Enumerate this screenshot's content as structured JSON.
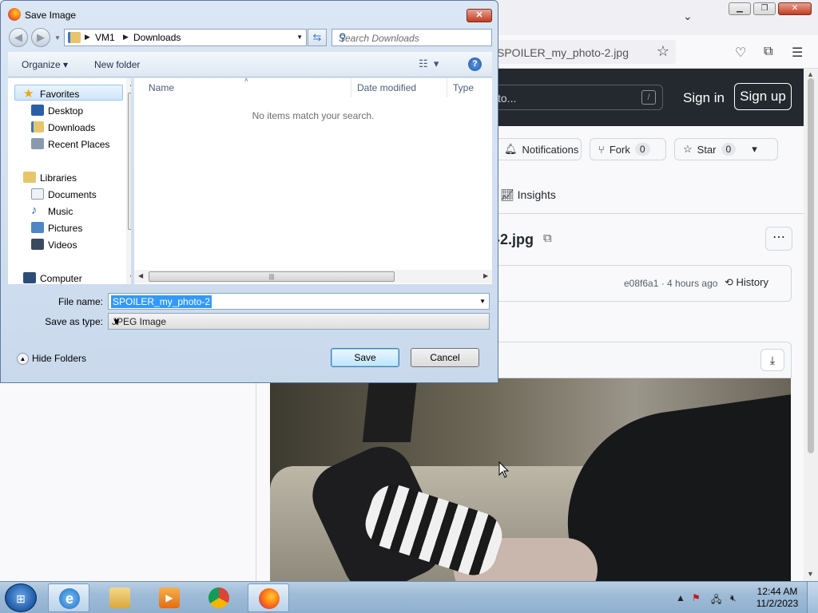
{
  "browser": {
    "url_text": "SPOILER_my_photo-2.jpg",
    "github": {
      "search_placeholder": "to...",
      "slash_key": "/",
      "sign_in": "Sign in",
      "sign_up": "Sign up",
      "notifications": "Notifications",
      "fork": "Fork",
      "fork_count": "0",
      "star": "Star",
      "star_count": "0",
      "insights": "Insights",
      "filename": "-2.jpg",
      "commit": "e08f6a1 · 4 hours ago",
      "history": "History"
    }
  },
  "dialog": {
    "title": "Save Image",
    "close": "✕",
    "breadcrumb": [
      "VM1",
      "Downloads"
    ],
    "search_placeholder": "Search Downloads",
    "organize": "Organize",
    "new_folder": "New folder",
    "help": "?",
    "nav": {
      "favorites": "Favorites",
      "items_fav": [
        "Desktop",
        "Downloads",
        "Recent Places"
      ],
      "libraries": "Libraries",
      "items_lib": [
        "Documents",
        "Music",
        "Pictures",
        "Videos"
      ],
      "computer": "Computer"
    },
    "columns": [
      "Name",
      "Date modified",
      "Type"
    ],
    "empty_message": "No items match your search.",
    "file_name_label": "File name:",
    "file_name_value": "SPOILER_my_photo-2",
    "save_type_label": "Save as type:",
    "save_type_value": "JPEG Image",
    "hide_folders": "Hide Folders",
    "save": "Save",
    "cancel": "Cancel"
  },
  "taskbar": {
    "time": "12:44 AM",
    "date": "11/2/2023",
    "apps": [
      "internet-explorer",
      "file-explorer",
      "media-player",
      "chrome",
      "firefox"
    ]
  },
  "colors": {
    "dialog_bg": "#dbe7f4",
    "github_header": "#24292f",
    "selection": "#3399ff",
    "taskbar": "#9fbcd7"
  }
}
